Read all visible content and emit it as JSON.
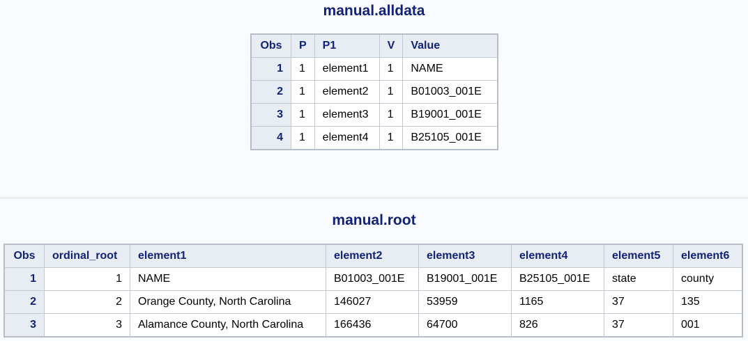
{
  "table1": {
    "title": "manual.alldata",
    "headers": [
      "Obs",
      "P",
      "P1",
      "V",
      "Value"
    ],
    "rows": [
      [
        "1",
        "1",
        "element1",
        "1",
        "NAME"
      ],
      [
        "2",
        "1",
        "element2",
        "1",
        "B01003_001E"
      ],
      [
        "3",
        "1",
        "element3",
        "1",
        "B19001_001E"
      ],
      [
        "4",
        "1",
        "element4",
        "1",
        "B25105_001E"
      ]
    ]
  },
  "table2": {
    "title": "manual.root",
    "headers": [
      "Obs",
      "ordinal_root",
      "element1",
      "element2",
      "element3",
      "element4",
      "element5",
      "element6"
    ],
    "rows": [
      [
        "1",
        "1",
        "NAME",
        "B01003_001E",
        "B19001_001E",
        "B25105_001E",
        "state",
        "county"
      ],
      [
        "2",
        "2",
        "Orange County, North Carolina",
        "146027",
        "53959",
        "1165",
        "37",
        "135"
      ],
      [
        "3",
        "3",
        "Alamance County, North Carolina",
        "166436",
        "64700",
        "826",
        "37",
        "001"
      ]
    ]
  }
}
